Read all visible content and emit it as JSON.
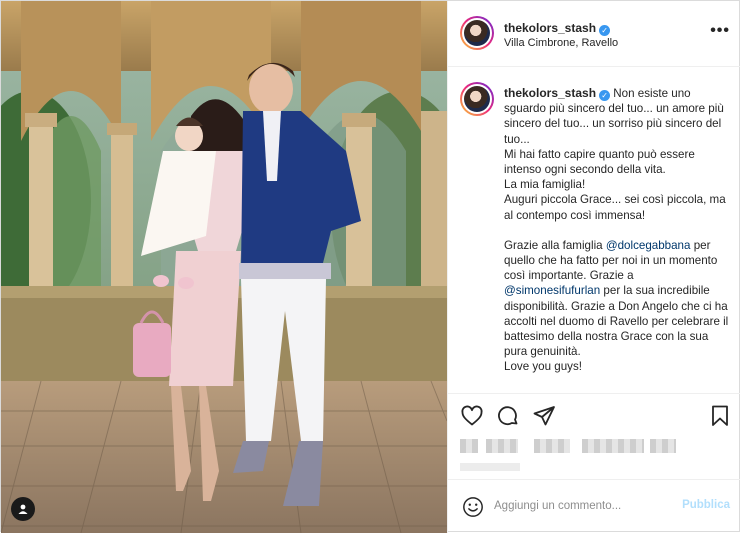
{
  "post": {
    "username": "thekolors_stash",
    "location": "Villa Cimbrone, Ravello",
    "more_icon": "more-horizontal-icon",
    "caption": {
      "username": "thekolors_stash",
      "line1": "Non esiste uno sguardo più sincero del tuo... un amore più sincero del tuo... un sorriso più sincero del tuo...",
      "line2": "Mi hai fatto capire quanto può essere intenso ogni secondo della vita.",
      "line3": "La mia famiglia!",
      "line4": "Auguri piccola Grace... sei così piccola, ma al contempo così immensa!",
      "p2_a": "Grazie alla famiglia",
      "mention1": "@dolcegabbana",
      "p2_b": "per quello che ha fatto per noi in un momento così importante. Grazie a",
      "mention2": "@simonesifufurlan",
      "p2_c": "per la sua incredibile disponibilità. Grazie a Don Angelo che ci ha accolti nel duomo di Ravello per celebrare il battesimo della nostra Grace con la sua pura genuinità.",
      "p3": "Love you guys!"
    },
    "actions": {
      "like_icon": "heart-icon",
      "comment_icon": "comment-icon",
      "share_icon": "paper-plane-icon",
      "save_icon": "bookmark-icon"
    },
    "comment_box": {
      "placeholder": "Aggiungi un commento...",
      "publish_label": "Pubblica",
      "emoji_icon": "smile-icon"
    }
  },
  "colors": {
    "verified": "#3897f0",
    "mention": "#00376b",
    "publish_disabled": "#b2dffc"
  }
}
